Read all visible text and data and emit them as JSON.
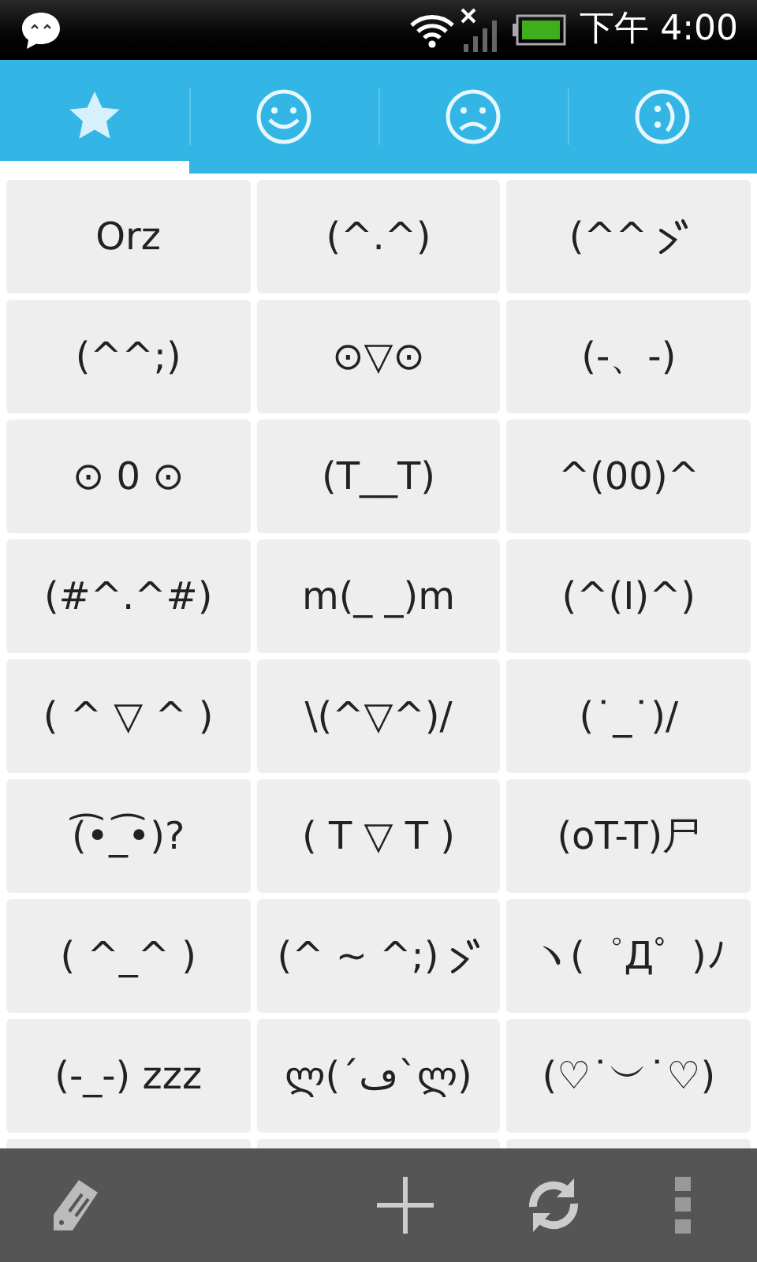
{
  "status_bar": {
    "time": "下午 4:00"
  },
  "tabs": [
    {
      "selected": true
    },
    {
      "selected": false
    },
    {
      "selected": false
    },
    {
      "selected": false
    }
  ],
  "emoticons": [
    [
      {
        "text": "Orz",
        "iteration_mark": false
      },
      {
        "text": "(^.^)",
        "iteration_mark": false
      },
      {
        "text": "(^^",
        "iteration_mark": true
      }
    ],
    [
      {
        "text": "(^^;)",
        "iteration_mark": false
      },
      {
        "text": "⊙▽⊙",
        "iteration_mark": false
      },
      {
        "text": "(-、-)",
        "iteration_mark": false
      }
    ],
    [
      {
        "text": "⊙ 0 ⊙",
        "iteration_mark": false
      },
      {
        "text": "(T__T)",
        "iteration_mark": false
      },
      {
        "text": "^(00)^",
        "iteration_mark": false
      }
    ],
    [
      {
        "text": "(#^.^#)",
        "iteration_mark": false
      },
      {
        "text": "m(_ _)m",
        "iteration_mark": false
      },
      {
        "text": "(^(I)^)",
        "iteration_mark": false
      }
    ],
    [
      {
        "text": "( ^ ▽ ^ )",
        "iteration_mark": false
      },
      {
        "text": "\\(^▽^)/",
        "iteration_mark": false
      },
      {
        "text": "(˙_˙)/",
        "iteration_mark": false
      }
    ],
    [
      {
        "text": "(͡•_͡•)?",
        "iteration_mark": false
      },
      {
        "text": "( T ▽ T )",
        "iteration_mark": false
      },
      {
        "text": "(oT-T)尸",
        "iteration_mark": false
      }
    ],
    [
      {
        "text": "(  ^_^  )",
        "iteration_mark": false
      },
      {
        "text": "(^ ~ ^;)",
        "iteration_mark": true
      },
      {
        "text": "ヽ(゜Д゜)ﾉ",
        "iteration_mark": false
      }
    ],
    [
      {
        "text": "(-_-) zzz",
        "iteration_mark": false
      },
      {
        "text": "ლ(´ڡ`ლ)",
        "iteration_mark": false
      },
      {
        "text": "(♡˙︶˙♡)",
        "iteration_mark": false
      }
    ]
  ]
}
